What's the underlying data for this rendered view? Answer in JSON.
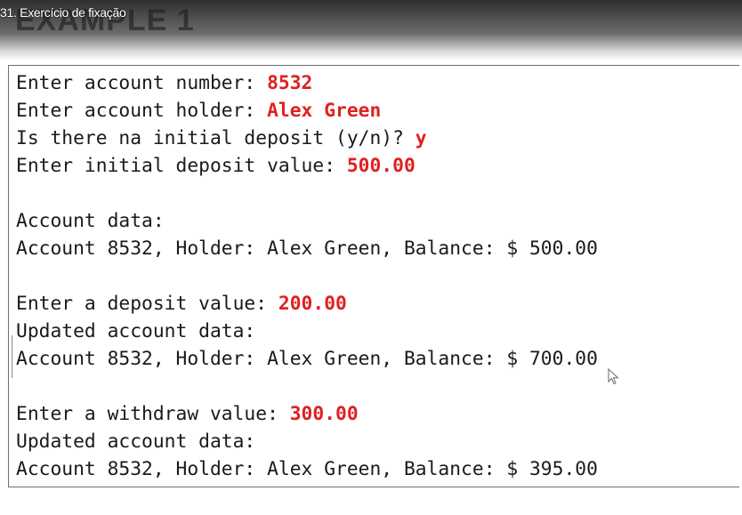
{
  "video": {
    "title": "31. Exercício de fixação"
  },
  "slide": {
    "heading": "EXAMPLE 1"
  },
  "console": {
    "lines": [
      {
        "prompt": "Enter account number: ",
        "input": "8532"
      },
      {
        "prompt": "Enter account holder: ",
        "input": "Alex Green"
      },
      {
        "prompt": "Is there na initial deposit (y/n)? ",
        "input": "y"
      },
      {
        "prompt": "Enter initial deposit value: ",
        "input": "500.00"
      },
      {
        "prompt": "",
        "input": ""
      },
      {
        "prompt": "Account data:",
        "input": ""
      },
      {
        "prompt": "Account 8532, Holder: Alex Green, Balance: $ 500.00",
        "input": ""
      },
      {
        "prompt": "",
        "input": ""
      },
      {
        "prompt": "Enter a deposit value: ",
        "input": "200.00"
      },
      {
        "prompt": "Updated account data:",
        "input": ""
      },
      {
        "prompt": "Account 8532, Holder: Alex Green, Balance: $ 700.00",
        "input": ""
      },
      {
        "prompt": "",
        "input": ""
      },
      {
        "prompt": "Enter a withdraw value: ",
        "input": "300.00"
      },
      {
        "prompt": "Updated account data:",
        "input": ""
      },
      {
        "prompt": "Account 8532, Holder: Alex Green, Balance: $ 395.00",
        "input": ""
      }
    ]
  },
  "colors": {
    "input_text": "#e02020",
    "console_text": "#1a1a1a"
  },
  "icons": {
    "cursor": "mouse-pointer-icon"
  }
}
